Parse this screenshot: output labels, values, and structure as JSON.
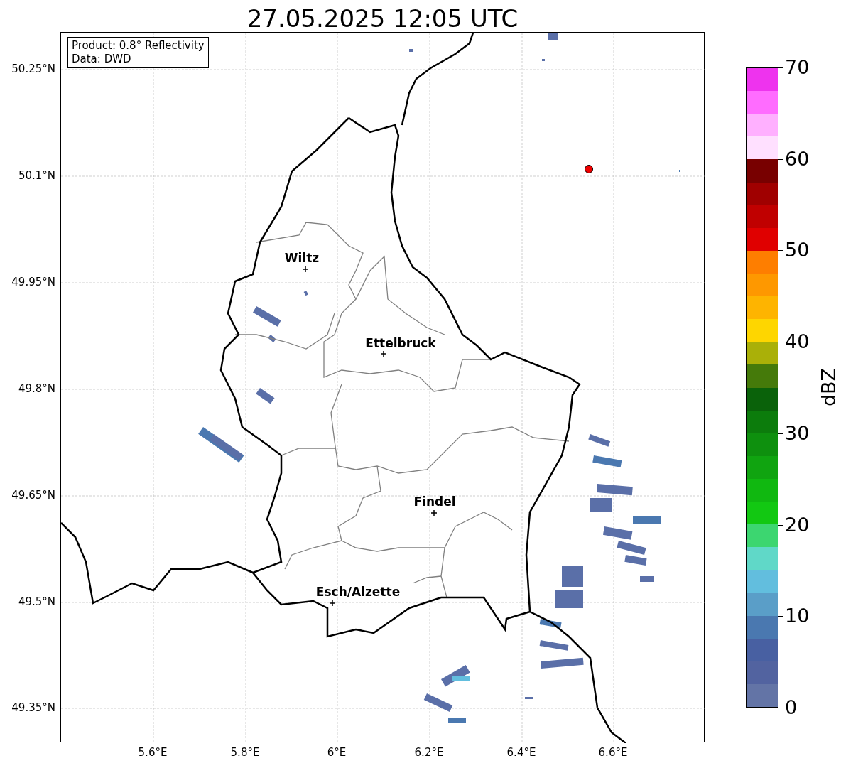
{
  "title": "27.05.2025 12:05 UTC",
  "info_box": {
    "lines": [
      "Product: 0.8° Reflectivity",
      "Data: DWD"
    ]
  },
  "map": {
    "y_ticks": [
      "50.25°N",
      "50.1°N",
      "49.95°N",
      "49.8°N",
      "49.65°N",
      "49.5°N",
      "49.35°N"
    ],
    "x_ticks": [
      "5.6°E",
      "5.8°E",
      "6°E",
      "6.2°E",
      "6.4°E",
      "6.6°E"
    ],
    "cities": [
      {
        "name": "Wiltz"
      },
      {
        "name": "Ettelbruck"
      },
      {
        "name": "Findel"
      },
      {
        "name": "Esch/Alzette"
      }
    ]
  },
  "colorbar": {
    "label": "dBZ",
    "ticks": [
      "70",
      "60",
      "50",
      "40",
      "30",
      "20",
      "10",
      "0"
    ],
    "bands": [
      {
        "color": "#ee33ee"
      },
      {
        "color": "#ff6cff"
      },
      {
        "color": "#ffb0ff"
      },
      {
        "color": "#ffe0ff"
      },
      {
        "color": "#780000"
      },
      {
        "color": "#a00000"
      },
      {
        "color": "#c00000"
      },
      {
        "color": "#e00000"
      },
      {
        "color": "#fe7e00"
      },
      {
        "color": "#fe9800"
      },
      {
        "color": "#feb400"
      },
      {
        "color": "#fed600"
      },
      {
        "color": "#aab008"
      },
      {
        "color": "#457a0a"
      },
      {
        "color": "#0a620a"
      },
      {
        "color": "#0c7c0c"
      },
      {
        "color": "#0e900e"
      },
      {
        "color": "#10a410"
      },
      {
        "color": "#10b810"
      },
      {
        "color": "#12c812"
      },
      {
        "color": "#3cd670"
      },
      {
        "color": "#60d8c8"
      },
      {
        "color": "#62bede"
      },
      {
        "color": "#5a9ec8"
      },
      {
        "color": "#4a78b0"
      },
      {
        "color": "#4860a2"
      },
      {
        "color": "#5263a0"
      },
      {
        "color": "#6374a6"
      }
    ]
  }
}
